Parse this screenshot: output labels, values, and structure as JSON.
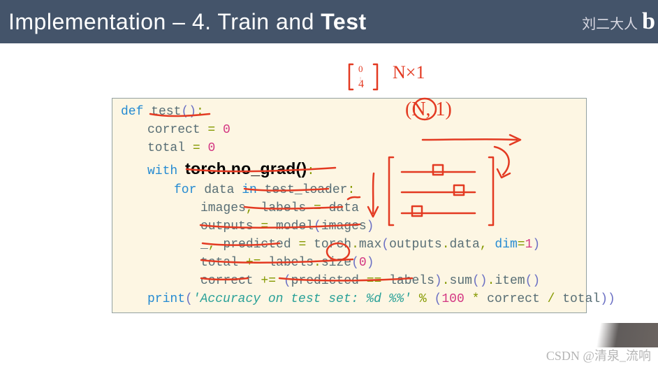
{
  "header": {
    "title_prefix": "Implementation – 4. Train and ",
    "title_bold": "Test",
    "author": "刘二大人",
    "logo": "b"
  },
  "code": {
    "l1_def": "def",
    "l1_name": " test",
    "l1_par": "()",
    "l1_colon": ":",
    "l2_a": "correct ",
    "l2_op": "=",
    "l2_b": " ",
    "l2_num": "0",
    "l3_a": "total ",
    "l3_op": "=",
    "l3_b": " ",
    "l3_num": "0",
    "l4_with": "with",
    "l4_space": " ",
    "l4_highlight": "torch.no_grad()",
    "l4_colon": ":",
    "l5_for": "for",
    "l5_a": " data ",
    "l5_in": "in",
    "l5_b": " test_loader",
    "l5_colon": ":",
    "l6_a": "images",
    "l6_comma": ",",
    "l6_b": " labels ",
    "l6_op": "=",
    "l6_c": " data",
    "l7_a": "outputs ",
    "l7_op": "=",
    "l7_b": " model",
    "l7_par_o": "(",
    "l7_c": "images",
    "l7_par_c": ")",
    "l8_a": "_",
    "l8_comma": ",",
    "l8_b": " predicted ",
    "l8_op": "=",
    "l8_c": " torch",
    "l8_dot": ".",
    "l8_max": "max",
    "l8_par_o": "(",
    "l8_d": "outputs",
    "l8_dot2": ".",
    "l8_e": "data",
    "l8_comma2": ",",
    "l8_f": " dim",
    "l8_eq": "=",
    "l8_num": "1",
    "l8_par_c": ")",
    "l9_a": "total ",
    "l9_op": "+=",
    "l9_b": " labels",
    "l9_dot": ".",
    "l9_c": "size",
    "l9_par_o": "(",
    "l9_num": "0",
    "l9_par_c": ")",
    "l10_a": "correct ",
    "l10_op": "+=",
    "l10_b": " ",
    "l10_par_o": "(",
    "l10_c": "predicted ",
    "l10_eq": "==",
    "l10_d": " labels",
    "l10_par_c": ")",
    "l10_dot": ".",
    "l10_sum": "sum",
    "l10_par2": "()",
    "l10_dot2": ".",
    "l10_item": "item",
    "l10_par3": "()",
    "l11_print": "print",
    "l11_par_o": "(",
    "l11_str": "'Accuracy on test set: %d %%'",
    "l11_a": " ",
    "l11_mod": "%",
    "l11_b": " ",
    "l11_par_o2": "(",
    "l11_num": "100",
    "l11_c": " ",
    "l11_mul": "*",
    "l11_d": " correct ",
    "l11_div": "/",
    "l11_e": " total",
    "l11_par_c2": ")",
    "l11_par_c": ")"
  },
  "annotations": {
    "top_matrix_label": "N×1",
    "shape_label": "(N, 1)"
  },
  "watermark": "CSDN @清泉_流响"
}
